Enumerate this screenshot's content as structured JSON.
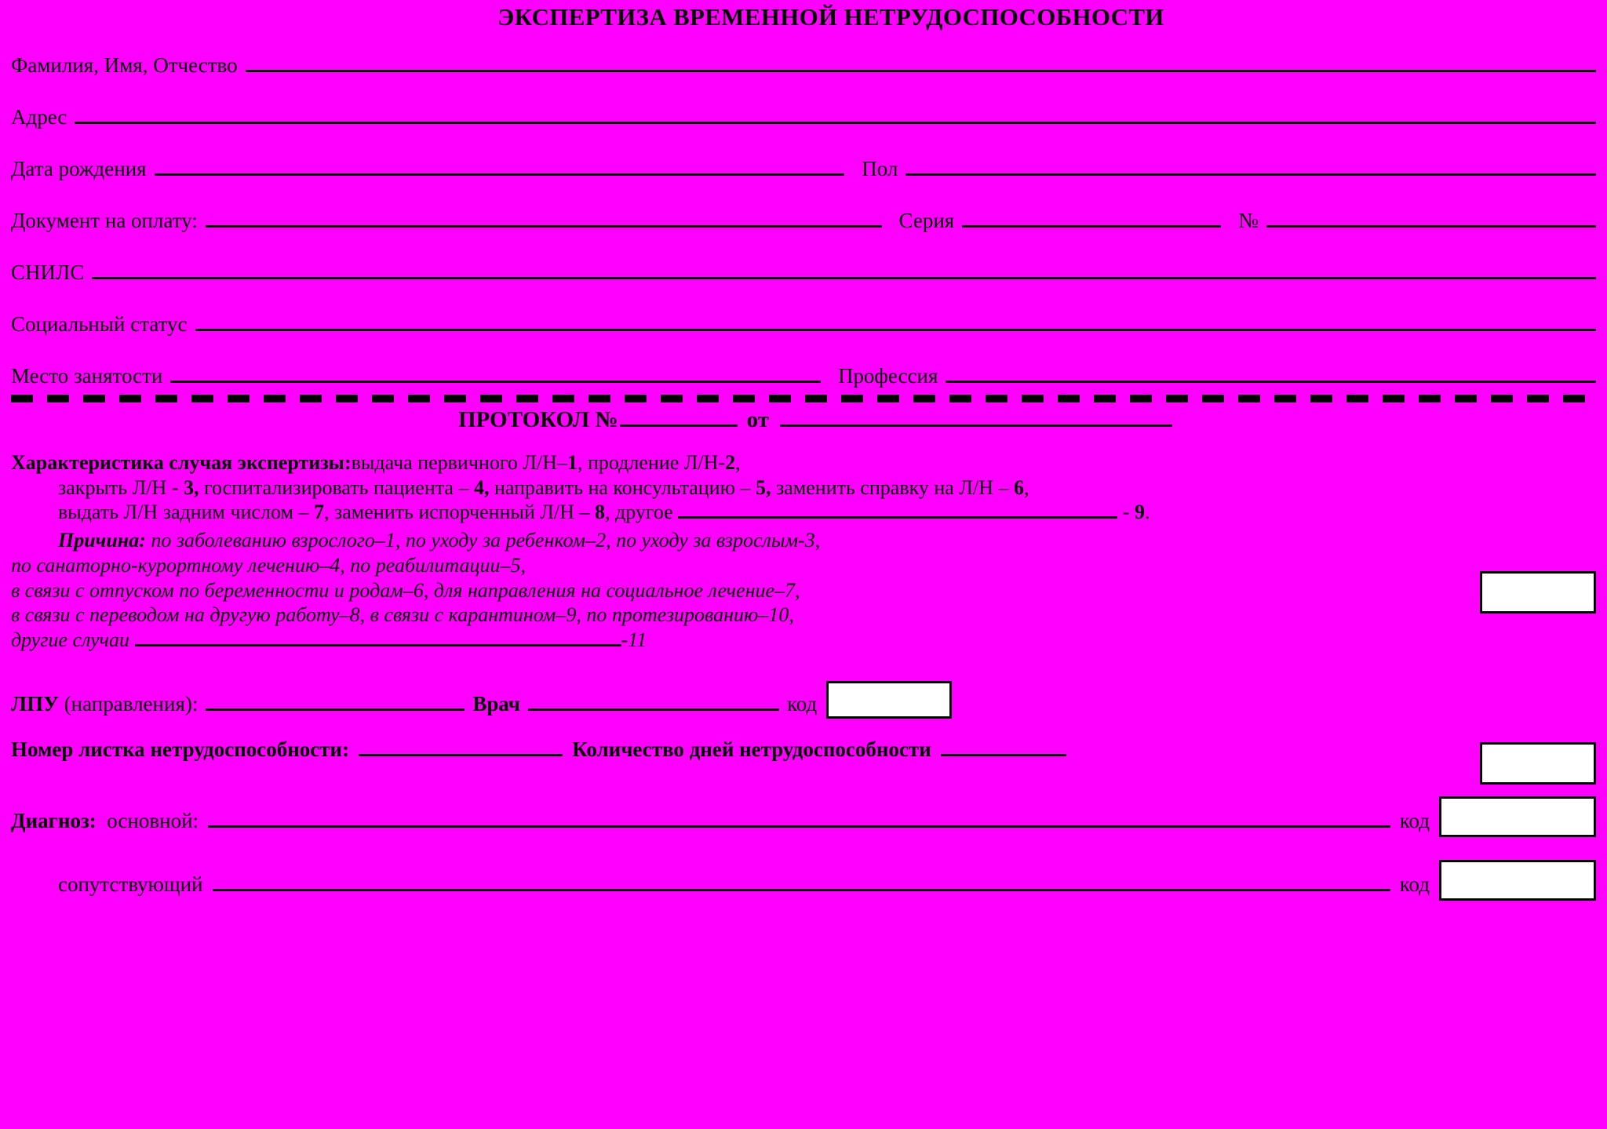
{
  "colors": {
    "background": "#FF00FF",
    "ink": "#000000",
    "box_fill": "#FFFFFF"
  },
  "title": "ЭКСПЕРТИЗА ВРЕМЕННОЙ НЕТРУДОСПОСОБНОСТИ",
  "patient_fields": {
    "fio_label": "Фамилия, Имя, Отчество",
    "address_label": "Адрес",
    "birthdate_label": "Дата рождения",
    "sex_label": "Пол",
    "payment_doc_label": "Документ на оплату:",
    "series_label": "Серия",
    "number_label": "№",
    "snils_label": "СНИЛС",
    "social_status_label": "Социальный статус",
    "employment_place_label": "Место занятости",
    "profession_label": "Профессия"
  },
  "protocol": {
    "label": "ПРОТОКОЛ №",
    "from_label": "от"
  },
  "characteristic": {
    "title": "Характеристика случая экспертизы:",
    "line1_rest": "выдача первичного Л/Н–",
    "code1": "1",
    "line1_tail": ", продление Л/Н-",
    "code2": "2",
    "line1_end": ",",
    "line2_a": "закрыть Л/Н  - ",
    "code3": "3,",
    "line2_b": " госпитализировать пациента – ",
    "code4": "4,",
    "line2_c": " направить на консультацию – ",
    "code5": "5,",
    "line2_d": " заменить справку на Л/Н – ",
    "code6": "6",
    "line2_end": ",",
    "line3_a": "выдать Л/Н задним числом – ",
    "code7": "7",
    "line3_b": ", заменить испорченный Л/Н – ",
    "code8": "8",
    "line3_c": ", другое ",
    "line3_d": " - ",
    "code9": "9",
    "line3_end": "."
  },
  "cause": {
    "title": "Причина:",
    "line1": "по заболеванию взрослого–1, по уходу за ребенком–2, по уходу за взрослым-3,",
    "line2": "по санаторно-курортному лечению–4, по реабилитации–5,",
    "line3": "в связи с отпуском по беременности и родам–6, для направления на социальное лечение–7,",
    "line4": "в связи с переводом на другую работу–8, в связи с карантином–9,  по протезированию–10,",
    "line5_label": "другие случаи",
    "line5_tail": "-11"
  },
  "lpu": {
    "label_bold": "ЛПУ",
    "label_rest": "(направления):",
    "doctor_label": "Врач",
    "code_label": "код"
  },
  "sheet": {
    "number_label": "Номер листка нетрудоспособности:",
    "days_label": "Количество дней нетрудоспособности"
  },
  "diagnosis": {
    "title": "Диагноз:",
    "main_label": "основной:",
    "concomitant_label": "сопутствующий",
    "code_label": "код"
  }
}
